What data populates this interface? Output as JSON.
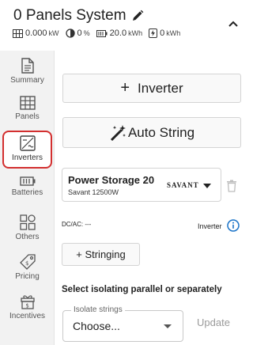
{
  "header": {
    "title": "0 Panels System",
    "stats": {
      "dc_value": "0.000",
      "dc_unit": "kW",
      "ratio_value": "0",
      "ratio_unit": "%",
      "battery_value": "20.0",
      "battery_unit": "kWh",
      "energy_value": "0",
      "energy_unit": "kWh"
    }
  },
  "sidebar": {
    "items": [
      {
        "label": "Summary",
        "icon": "document-icon"
      },
      {
        "label": "Panels",
        "icon": "panel-grid-icon"
      },
      {
        "label": "Inverters",
        "icon": "inverter-icon"
      },
      {
        "label": "Batteries",
        "icon": "battery-icon"
      },
      {
        "label": "Others",
        "icon": "others-icon"
      },
      {
        "label": "Pricing",
        "icon": "price-tag-icon"
      },
      {
        "label": "Incentives",
        "icon": "gift-icon"
      }
    ],
    "active": "Inverters"
  },
  "main": {
    "inverter_button": "Inverter",
    "auto_string_button": "Auto String",
    "storage": {
      "name": "Power Storage 20",
      "model": "Savant 12500W",
      "brand": "SAVANT"
    },
    "dcac_label": "DC/AC: ---",
    "inverter_label": "Inverter",
    "stringing_button": "+ Stringing",
    "isolate_heading": "Select isolating parallel or separately",
    "isolate_select": {
      "legend": "Isolate strings",
      "value": "Choose..."
    },
    "update_button": "Update"
  },
  "colors": {
    "active_border": "#d32f2f",
    "info_blue": "#1a73c8",
    "sidebar_bg": "#f2f2f2"
  }
}
